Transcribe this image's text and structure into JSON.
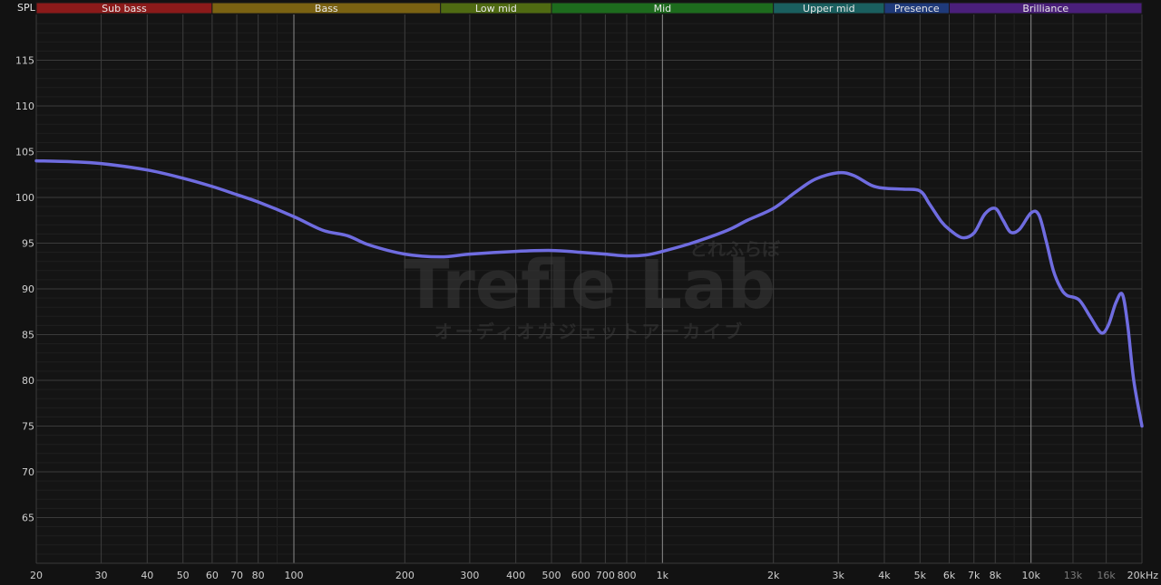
{
  "chart_data": {
    "type": "line",
    "title": "",
    "ylabel": "SPL",
    "xlabel": "",
    "x_scale": "log",
    "xlim": [
      20,
      20000
    ],
    "ylim": [
      60,
      120
    ],
    "y_ticks": [
      65,
      70,
      75,
      80,
      85,
      90,
      95,
      100,
      105,
      110,
      115
    ],
    "x_ticks": [
      {
        "value": 20,
        "label": "20"
      },
      {
        "value": 30,
        "label": "30"
      },
      {
        "value": 40,
        "label": "40"
      },
      {
        "value": 50,
        "label": "50"
      },
      {
        "value": 60,
        "label": "60"
      },
      {
        "value": 70,
        "label": "70"
      },
      {
        "value": 80,
        "label": "80"
      },
      {
        "value": 100,
        "label": "100"
      },
      {
        "value": 200,
        "label": "200"
      },
      {
        "value": 300,
        "label": "300"
      },
      {
        "value": 400,
        "label": "400"
      },
      {
        "value": 500,
        "label": "500"
      },
      {
        "value": 600,
        "label": "600"
      },
      {
        "value": 700,
        "label": "700"
      },
      {
        "value": 800,
        "label": "800"
      },
      {
        "value": 1000,
        "label": "1k"
      },
      {
        "value": 2000,
        "label": "2k"
      },
      {
        "value": 3000,
        "label": "3k"
      },
      {
        "value": 4000,
        "label": "4k"
      },
      {
        "value": 5000,
        "label": "5k"
      },
      {
        "value": 6000,
        "label": "6k"
      },
      {
        "value": 7000,
        "label": "7k"
      },
      {
        "value": 8000,
        "label": "8k"
      },
      {
        "value": 10000,
        "label": "10k"
      },
      {
        "value": 13000,
        "label": "13k",
        "dim": true
      },
      {
        "value": 16000,
        "label": "16k",
        "dim": true
      },
      {
        "value": 20000,
        "label": "20kHz"
      }
    ],
    "bands": [
      {
        "name": "Sub bass",
        "from": 20,
        "to": 60,
        "color": "#8b1a1a"
      },
      {
        "name": "Bass",
        "from": 60,
        "to": 250,
        "color": "#7a6212"
      },
      {
        "name": "Low mid",
        "from": 250,
        "to": 500,
        "color": "#4f6a12"
      },
      {
        "name": "Mid",
        "from": 500,
        "to": 2000,
        "color": "#1d6b1d"
      },
      {
        "name": "Upper mid",
        "from": 2000,
        "to": 4000,
        "color": "#1a5f5f"
      },
      {
        "name": "Presence",
        "from": 4000,
        "to": 6000,
        "color": "#1f3a7a"
      },
      {
        "name": "Brilliance",
        "from": 6000,
        "to": 20000,
        "color": "#4a1f7a"
      }
    ],
    "grid": true,
    "series": [
      {
        "name": "",
        "color": "#6f6ce0",
        "x": [
          20,
          25,
          30,
          40,
          50,
          60,
          70,
          80,
          100,
          120,
          140,
          160,
          200,
          250,
          300,
          400,
          500,
          600,
          700,
          800,
          900,
          1000,
          1200,
          1500,
          1700,
          2000,
          2300,
          2600,
          3000,
          3300,
          3700,
          4000,
          4500,
          5000,
          5300,
          5700,
          6000,
          6500,
          7000,
          7500,
          8000,
          8400,
          8800,
          9300,
          10000,
          10500,
          11000,
          11500,
          12000,
          12500,
          13500,
          14500,
          15500,
          16200,
          17000,
          17700,
          18300,
          19000,
          20000
        ],
        "y": [
          104.0,
          103.9,
          103.7,
          103.0,
          102.1,
          101.2,
          100.3,
          99.5,
          97.9,
          96.4,
          95.8,
          94.8,
          93.8,
          93.5,
          93.8,
          94.1,
          94.2,
          94.0,
          93.8,
          93.6,
          93.7,
          94.1,
          95.0,
          96.4,
          97.5,
          98.8,
          100.6,
          102.0,
          102.7,
          102.4,
          101.3,
          101.0,
          100.9,
          100.7,
          99.3,
          97.4,
          96.5,
          95.6,
          96.1,
          98.2,
          98.8,
          97.5,
          96.2,
          96.5,
          98.3,
          98.1,
          95.2,
          92.0,
          90.2,
          89.3,
          88.8,
          86.9,
          85.2,
          86.0,
          88.5,
          89.4,
          86.0,
          80.0,
          75.0
        ]
      }
    ]
  },
  "watermark": {
    "title": "Trefle Lab",
    "brand_jp": "とれふらぼ",
    "subtitle": "オーディオガジェットアーカイブ"
  }
}
